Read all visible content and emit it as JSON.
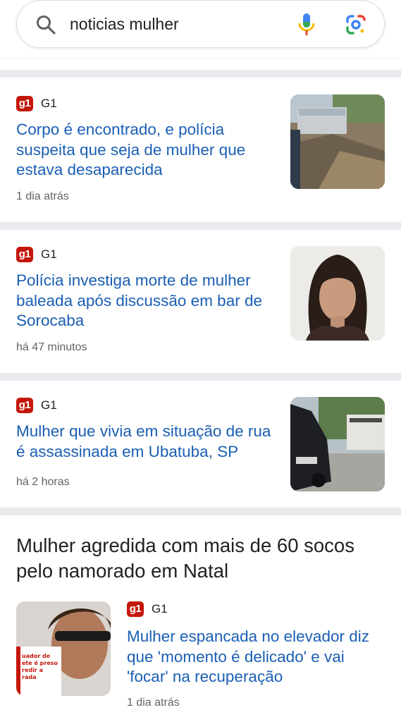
{
  "search": {
    "query": "noticias mulher"
  },
  "articles": [
    {
      "source": "G1",
      "logo": "g1",
      "headline": "Corpo é encontrado, e polícia suspeita que seja de mulher que estava desaparecida",
      "time": "1 dia atrás"
    },
    {
      "source": "G1",
      "logo": "g1",
      "headline": "Polícia investiga morte de mulher baleada após discussão em bar de Sorocaba",
      "time": "há 47 minutos"
    },
    {
      "source": "G1",
      "logo": "g1",
      "headline": "Mulher que vivia em situação de rua é assassinada em Ubatuba, SP",
      "time": "há 2 horas"
    }
  ],
  "story": {
    "title": "Mulher agredida com mais de 60 socos pelo namorado em Natal",
    "article": {
      "source": "G1",
      "logo": "g1",
      "headline": "Mulher espancada no elevador diz que 'momento é delicado' e vai 'focar' na recuperação",
      "time": "1 dia atrás"
    },
    "thumb_caption": "uador de ete é preso redir a rada"
  },
  "colors": {
    "link": "#1a5fb4",
    "g1_red": "#c4170c",
    "divider": "#e8eaed"
  },
  "icons": [
    "search-icon",
    "mic-icon",
    "google-lens-icon",
    "g1-logo"
  ]
}
